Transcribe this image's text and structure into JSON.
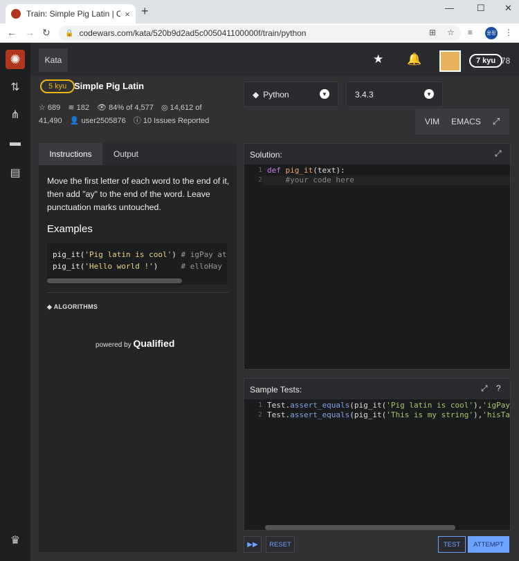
{
  "browser": {
    "tab_title": "Train: Simple Pig Latin | Codewars",
    "tab_close": "×",
    "new_tab": "+",
    "url": "codewars.com/kata/520b9d2ad5c005041100000f/train/python",
    "profile": "윤정",
    "win_min": "—",
    "win_max": "☐",
    "win_close": "✕"
  },
  "topbar": {
    "kata_label": "Kata",
    "rank_badge": "7 kyu",
    "honor": "78"
  },
  "kata": {
    "rank": "5 kyu",
    "title": "Simple Pig Latin",
    "stars": "689",
    "collections": "182",
    "satisfaction": "84% of 4,577",
    "completed_a": "14,612 of",
    "completed_b": "41,490",
    "author": "user2505876",
    "issues": "10 Issues Reported"
  },
  "editor_opts": {
    "language": "Python",
    "version": "3.4.3",
    "vim": "VIM",
    "emacs": "EMACS"
  },
  "instructions": {
    "tab_instructions": "Instructions",
    "tab_output": "Output",
    "description": "Move the first letter of each word to the end of it, then add \"ay\" to the end of the word. Leave punctuation marks untouched.",
    "examples_heading": "Examples",
    "tag": "ALGORITHMS",
    "powered_by": "powered by",
    "brand": "Qualified"
  },
  "examples": [
    {
      "fn": "pig_it(",
      "arg": "'Pig latin is cool'",
      "close": ") ",
      "comment": "# igPay atinla"
    },
    {
      "fn": "pig_it(",
      "arg": "'Hello world !'",
      "close": ")     ",
      "comment": "# elloHay orld"
    }
  ],
  "solution": {
    "heading": "Solution:",
    "line1_num": "1",
    "line2_num": "2",
    "kw": "def",
    "fn": "pig_it",
    "sig": "(text):",
    "comment": "#your code here"
  },
  "tests": {
    "heading": "Sample Tests:",
    "lines": [
      {
        "num": "1",
        "obj": "Test.",
        "method": "assert_equals",
        "pre": "(pig_it(",
        "s1": "'Pig latin is cool'",
        "mid": "),",
        "s2": "'igPay atin"
      },
      {
        "num": "2",
        "obj": "Test.",
        "method": "assert_equals",
        "pre": "(pig_it(",
        "s1": "'This is my string'",
        "mid": "),",
        "s2": "'hisTay siay"
      }
    ]
  },
  "actions": {
    "reset": "RESET",
    "test": "TEST",
    "attempt": "ATTEMPT"
  }
}
